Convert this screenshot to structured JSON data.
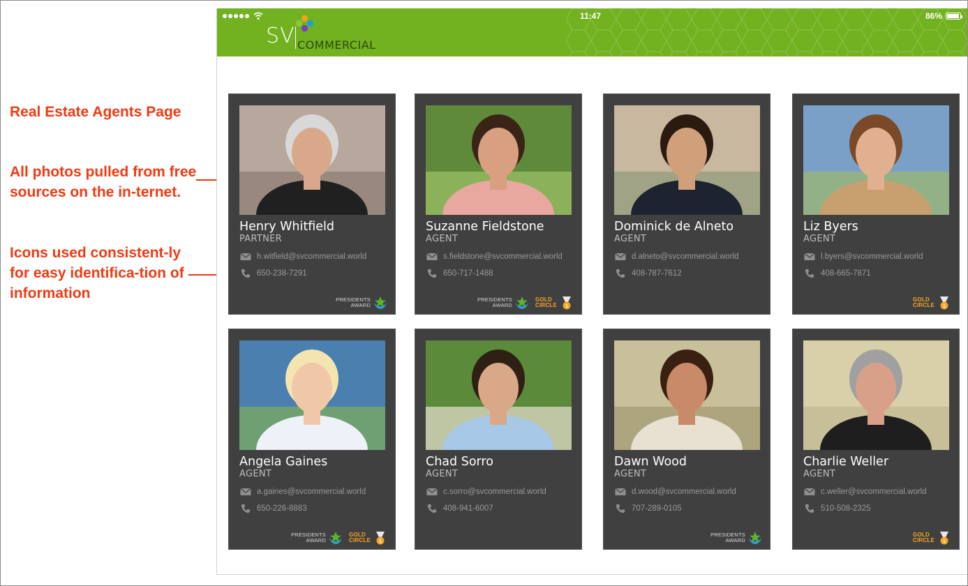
{
  "annotations": {
    "title": "Real Estate Agents Page",
    "photos_note": "All photos pulled from free sources on the in-ternet.",
    "icons_note": "Icons used consistent-ly for easy identifica-tion of information"
  },
  "status_bar": {
    "time": "11:47",
    "battery": "86%",
    "battery_level": 0.86,
    "signal_dots": 5
  },
  "header": {
    "logo_sv": "SV",
    "logo_commercial": "COMMERCIAL",
    "bar_color": "#72b120"
  },
  "badges": {
    "presidents_award": "PRESIDENTS\nAWARD",
    "gold_circle": "GOLD\nCIRCLE"
  },
  "agents": [
    {
      "name": "Henry Whitfield",
      "role": "PARTNER",
      "email": "h.witfield@svcommercial.world",
      "phone": "650-238-7291",
      "presidents_award": true,
      "gold_circle": false
    },
    {
      "name": "Suzanne Fieldstone",
      "role": "AGENT",
      "email": "s.fieldstone@svcommercial.world",
      "phone": "650-717-1488",
      "presidents_award": true,
      "gold_circle": true
    },
    {
      "name": "Dominick de Alneto",
      "role": "AGENT",
      "email": "d.alneto@svcommercial.world",
      "phone": "408-787-7612",
      "presidents_award": false,
      "gold_circle": false
    },
    {
      "name": "Liz Byers",
      "role": "AGENT",
      "email": "l.byers@svcommercial.world",
      "phone": "408-665-7871",
      "presidents_award": false,
      "gold_circle": true
    },
    {
      "name": "Angela Gaines",
      "role": "AGENT",
      "email": "a.gaines@svcommercial.world",
      "phone": "650-226-8883",
      "presidents_award": true,
      "gold_circle": true
    },
    {
      "name": "Chad Sorro",
      "role": "AGENT",
      "email": "c.sorro@svcommercial.world",
      "phone": "408-941-6007",
      "presidents_award": false,
      "gold_circle": false
    },
    {
      "name": "Dawn Wood",
      "role": "AGENT",
      "email": "d.wood@svcommercial.world",
      "phone": "707-289-0105",
      "presidents_award": true,
      "gold_circle": false
    },
    {
      "name": "Charlie Weller",
      "role": "AGENT",
      "email": "c.weller@svcommercial.world",
      "phone": "510-508-2325",
      "presidents_award": false,
      "gold_circle": true
    }
  ]
}
